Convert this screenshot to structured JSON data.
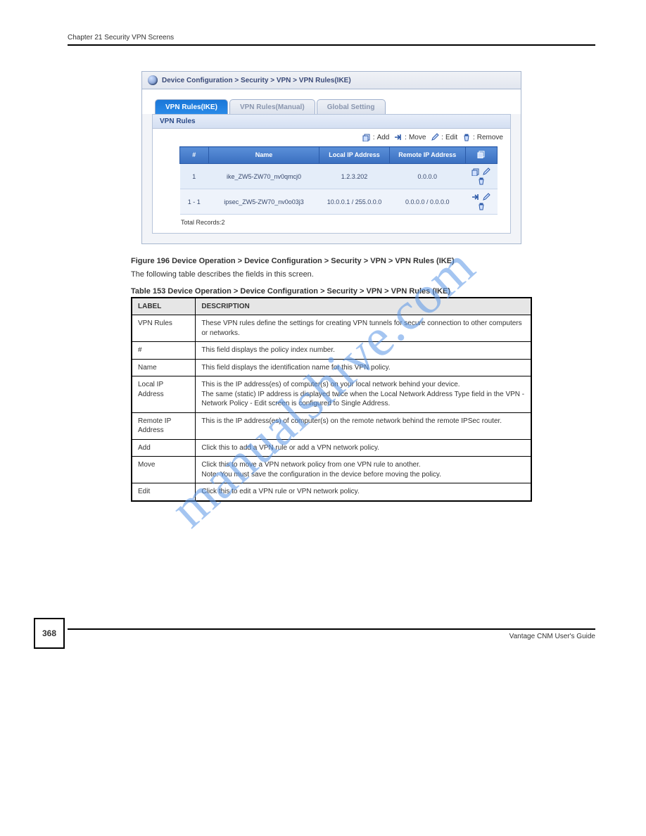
{
  "chapter_head": "Chapter 21 Security VPN Screens",
  "figure_caption": "Figure 196   Device Operation > Device Configuration > Security > VPN > VPN Rules (IKE)",
  "intro_body": "The following table describes the fields in this screen.",
  "table_caption": "Table 153   Device Operation > Device Configuration > Security > VPN > VPN Rules (IKE)",
  "watermark": "manualshive.com",
  "page_number": "368",
  "footer_text": "Vantage CNM User's Guide",
  "app": {
    "breadcrumb": "Device Configuration > Security > VPN > VPN Rules(IKE)",
    "tabs": [
      {
        "label": "VPN Rules(IKE)",
        "active": true
      },
      {
        "label": "VPN Rules(Manual)",
        "active": false
      },
      {
        "label": "Global Setting",
        "active": false
      }
    ],
    "section_title": "VPN Rules",
    "toolbar": [
      {
        "icon": "add-icon",
        "label": "Add"
      },
      {
        "icon": "move-icon",
        "label": "Move"
      },
      {
        "icon": "edit-icon",
        "label": "Edit"
      },
      {
        "icon": "remove-icon",
        "label": "Remove"
      }
    ],
    "columns": {
      "idx": "#",
      "name": "Name",
      "local": "Local IP Address",
      "remote": "Remote IP Address",
      "actions_icon": "add-icon"
    },
    "rows": [
      {
        "idx": "1",
        "name": "ike_ZW5-ZW70_nv0qmcj0",
        "local": "1.2.3.202",
        "remote": "0.0.0.0",
        "actions": [
          "add-icon",
          "edit-icon",
          "remove-icon"
        ]
      },
      {
        "idx": "1 - 1",
        "name": "ipsec_ZW5-ZW70_nv0o03j3",
        "local": "10.0.0.1 / 255.0.0.0",
        "remote": "0.0.0.0 / 0.0.0.0",
        "actions": [
          "move-icon",
          "edit-icon",
          "remove-icon"
        ]
      }
    ],
    "total_records": "Total Records:2"
  },
  "desc_table": {
    "head": {
      "label": "LABEL",
      "desc": "DESCRIPTION"
    },
    "rows": [
      {
        "label": "VPN Rules",
        "desc": "These VPN rules define the settings for creating VPN tunnels for secure connection to other computers or networks."
      },
      {
        "label": "#",
        "desc": "This field displays the policy index number."
      },
      {
        "label": "Name",
        "desc": "This field displays the identification name for this VPN policy."
      },
      {
        "label": "Local IP Address",
        "desc": "This is the IP address(es) of computer(s) on your local network behind your device.\nThe same (static) IP address is displayed twice when the Local Network Address Type field in the VPN - Network Policy - Edit screen is configured to Single Address."
      },
      {
        "label": "Remote IP Address",
        "desc": "This is the IP address(es) of computer(s) on the remote network behind the remote IPSec router."
      },
      {
        "label": "Add",
        "desc": "Click this to add a VPN rule or add a VPN network policy."
      },
      {
        "label": "Move",
        "desc": "Click this to move a VPN network policy from one VPN rule to another.\nNote: You must save the configuration in the device before moving the policy."
      },
      {
        "label": "Edit",
        "desc": "Click this to edit a VPN rule or VPN network policy."
      }
    ]
  },
  "icons": {
    "add-icon": "add",
    "move-icon": "move",
    "edit-icon": "edit",
    "remove-icon": "remove"
  }
}
